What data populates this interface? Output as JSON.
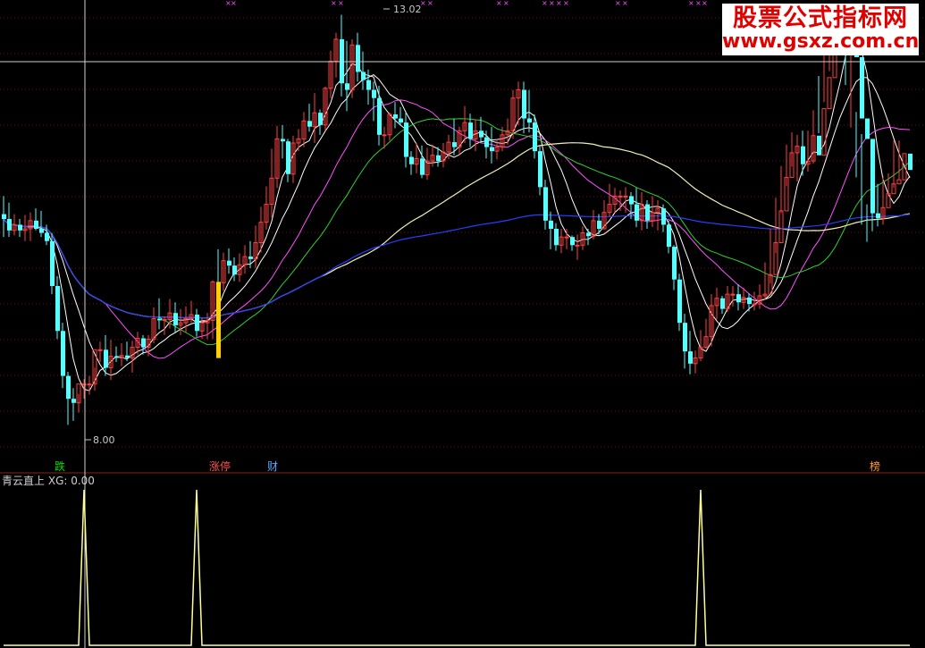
{
  "watermark": {
    "line1": "股票公式指标网",
    "line2": "www.gsxz.com.cn"
  },
  "indicator": {
    "name": "青云直上",
    "value_label": "XG: 0.00"
  },
  "annotations": {
    "high": "13.02",
    "low": "8.00"
  },
  "tags": [
    {
      "text": "跌",
      "color": "#00dd00"
    },
    {
      "text": "涨停",
      "color": "#ff5050"
    },
    {
      "text": "财",
      "color": "#5fa8ff"
    },
    {
      "text": "榜",
      "color": "#ff9a2a"
    }
  ],
  "colors": {
    "up": "#ff4040",
    "down": "#54ffff",
    "signal": "#ffd000",
    "ma_long": "#2a3cff",
    "ma_mid": "#ff50ff",
    "ma_slow": "#30d030",
    "ma_white": "#ffffff",
    "ma_cream": "#f0f0b8",
    "indicator": "#ffff99"
  },
  "chart_data": [
    {
      "type": "candlestick",
      "ylim": [
        7.6,
        13.2
      ],
      "x": [
        0,
        1,
        2,
        3,
        4,
        5,
        6,
        7,
        8,
        9,
        10,
        11,
        12,
        13,
        14,
        15,
        16,
        17,
        18,
        19,
        20,
        21,
        22,
        23,
        24,
        25,
        26,
        27,
        28,
        29,
        30,
        31,
        32,
        33,
        34,
        35,
        36,
        37,
        38,
        39,
        40,
        41,
        42,
        43,
        44,
        45,
        46,
        47,
        48,
        49,
        50,
        51,
        52,
        53,
        54,
        55,
        56,
        57,
        58,
        59,
        60,
        61,
        62,
        63,
        64,
        65,
        66,
        67,
        68,
        69,
        70,
        71,
        72,
        73,
        74,
        75,
        76,
        77,
        78,
        79,
        80,
        81,
        82,
        83,
        84,
        85,
        86,
        87,
        88,
        89,
        90,
        91,
        92,
        93,
        94,
        95,
        96,
        97,
        98,
        99,
        100,
        101,
        102,
        103,
        104,
        105,
        106,
        107,
        108,
        109,
        110,
        111,
        112,
        113,
        114,
        115,
        116,
        117,
        118,
        119,
        120,
        121,
        122,
        123,
        124,
        125,
        126,
        127,
        128,
        129,
        130,
        131,
        132,
        133,
        134,
        135,
        136,
        137,
        138,
        139,
        140,
        141,
        142,
        143,
        144,
        145,
        146,
        147,
        148,
        149,
        150,
        151,
        152,
        153,
        154,
        155,
        156,
        157,
        158,
        159,
        160,
        161,
        162,
        163,
        164,
        165,
        166,
        167,
        168,
        169
      ],
      "series": [
        {
          "name": "open",
          "values": [
            10.58,
            10.52,
            10.38,
            10.45,
            10.38,
            10.4,
            10.5,
            10.4,
            10.35,
            10.25,
            9.7,
            9.15,
            8.6,
            8.32,
            8.27,
            8.5,
            8.5,
            8.5,
            8.92,
            8.92,
            8.7,
            8.84,
            8.82,
            8.85,
            8.82,
            8.95,
            9.06,
            8.95,
            9.05,
            9.3,
            9.28,
            9.29,
            9.37,
            9.22,
            9.25,
            9.3,
            9.35,
            9.15,
            9.25,
            9.28,
            9.75,
            9.74,
            10.01,
            9.95,
            9.84,
            9.96,
            10.06,
            10.03,
            10.23,
            10.48,
            10.7,
            11.02,
            11.5,
            11.47,
            11.07,
            11.45,
            11.5,
            11.72,
            11.65,
            11.82,
            11.67,
            12.12,
            12.45,
            12.72,
            12.18,
            12.1,
            12.65,
            12.32,
            12.22,
            12.1,
            12.0,
            11.55,
            11.55,
            11.8,
            11.75,
            11.7,
            11.28,
            11.19,
            11.26,
            11.06,
            11.23,
            11.3,
            11.23,
            11.34,
            11.46,
            11.4,
            11.6,
            11.7,
            11.5,
            11.6,
            11.52,
            11.4,
            11.35,
            11.4,
            11.55,
            11.6,
            12.0,
            12.1,
            11.75,
            11.7,
            11.35,
            10.91,
            10.5,
            10.4,
            10.2,
            10.3,
            10.3,
            10.2,
            10.2,
            10.35,
            10.31,
            10.5,
            10.4,
            10.6,
            10.7,
            10.8,
            10.8,
            10.8,
            10.7,
            10.5,
            10.7,
            10.5,
            10.6,
            10.65,
            10.45,
            10.18,
            9.78,
            9.25,
            8.9,
            8.75,
            8.82,
            8.95,
            9.08,
            9.46,
            9.55,
            9.42,
            9.6,
            9.6,
            9.5,
            9.56,
            9.48,
            9.48,
            9.58,
            9.6,
            9.84,
            10.23,
            10.62,
            11.03,
            11.33,
            11.41,
            11.19,
            11.23,
            11.54,
            11.3,
            11.87,
            12.25,
            12.65,
            12.9,
            12.87,
            12.9,
            12.5,
            11.75,
            11.5,
            10.59,
            10.53,
            10.66,
            10.83,
            10.95,
            11.0,
            11.32
          ]
        },
        {
          "name": "high",
          "values": [
            10.8,
            10.72,
            10.58,
            10.52,
            10.57,
            10.6,
            10.65,
            10.62,
            10.45,
            10.35,
            9.82,
            9.25,
            8.65,
            8.45,
            8.38,
            8.56,
            8.6,
            8.7,
            9.02,
            9.1,
            9.04,
            8.96,
            9.0,
            9.02,
            9.03,
            9.14,
            9.1,
            9.1,
            9.44,
            9.55,
            9.33,
            9.54,
            9.5,
            9.42,
            9.45,
            9.52,
            9.42,
            9.31,
            9.37,
            9.77,
            10.15,
            10.11,
            10.16,
            10.05,
            10.1,
            10.2,
            10.25,
            10.44,
            10.67,
            10.92,
            11.38,
            11.66,
            11.67,
            11.5,
            11.54,
            11.62,
            11.83,
            11.93,
            12.06,
            11.86,
            12.14,
            12.58,
            12.8,
            13.02,
            12.7,
            12.72,
            12.8,
            12.57,
            12.35,
            12.2,
            12.15,
            11.65,
            11.82,
            11.95,
            11.89,
            11.84,
            11.35,
            11.45,
            11.42,
            11.39,
            11.43,
            11.4,
            11.45,
            11.55,
            11.75,
            11.65,
            11.9,
            11.81,
            11.73,
            11.77,
            11.6,
            11.65,
            11.5,
            11.65,
            11.75,
            12.1,
            12.2,
            12.2,
            12.1,
            11.8,
            11.41,
            11.0,
            10.61,
            10.47,
            10.4,
            10.4,
            10.32,
            10.33,
            10.43,
            10.4,
            10.63,
            10.58,
            10.75,
            10.95,
            10.9,
            10.87,
            10.91,
            10.85,
            10.9,
            10.85,
            10.75,
            10.8,
            10.75,
            10.7,
            10.5,
            10.2,
            9.85,
            9.36,
            9.15,
            8.91,
            9.16,
            9.3,
            9.6,
            9.68,
            9.58,
            9.7,
            9.7,
            9.72,
            9.68,
            9.61,
            9.63,
            9.72,
            9.99,
            10.4,
            10.78,
            11.17,
            11.43,
            11.58,
            11.55,
            11.6,
            11.6,
            11.85,
            12.27,
            12.7,
            13.0,
            12.95,
            13.1,
            12.93,
            12.6,
            11.83,
            11.56,
            10.7,
            10.76,
            10.95,
            11.05,
            11.08,
            11.48,
            11.48
          ]
        },
        {
          "name": "low",
          "values": [
            10.3,
            10.3,
            10.32,
            10.3,
            10.25,
            10.25,
            10.38,
            10.3,
            10.2,
            9.6,
            9.05,
            8.45,
            8.0,
            8.05,
            8.15,
            8.32,
            8.37,
            8.42,
            8.77,
            8.6,
            8.55,
            8.77,
            8.72,
            8.78,
            8.64,
            8.86,
            8.86,
            8.84,
            9.0,
            9.17,
            9.1,
            9.18,
            9.13,
            9.1,
            9.13,
            9.25,
            9.08,
            9.05,
            9.05,
            9.05,
            9.56,
            9.64,
            9.85,
            9.76,
            9.75,
            9.85,
            9.92,
            9.92,
            10.11,
            10.39,
            10.54,
            10.9,
            11.26,
            10.97,
            10.96,
            11.35,
            11.4,
            11.59,
            11.45,
            11.55,
            11.6,
            12.0,
            12.25,
            12.02,
            11.84,
            12.0,
            12.2,
            12.1,
            11.92,
            11.72,
            11.42,
            11.38,
            11.48,
            11.63,
            11.66,
            11.15,
            11.06,
            11.08,
            11.02,
            11.0,
            11.16,
            11.16,
            11.15,
            11.25,
            11.3,
            11.3,
            11.45,
            11.4,
            11.35,
            11.45,
            11.26,
            11.2,
            11.25,
            11.35,
            11.43,
            11.5,
            11.67,
            11.57,
            11.58,
            11.26,
            10.81,
            10.39,
            10.15,
            10.13,
            10.1,
            10.15,
            10.13,
            10.02,
            10.14,
            10.2,
            10.27,
            10.33,
            10.39,
            10.55,
            10.6,
            10.62,
            10.6,
            10.52,
            10.42,
            10.38,
            10.4,
            10.42,
            10.38,
            10.36,
            10.1,
            9.65,
            9.15,
            8.69,
            8.62,
            8.63,
            8.78,
            8.93,
            8.96,
            9.29,
            9.36,
            9.38,
            9.45,
            9.4,
            9.42,
            9.39,
            9.4,
            9.42,
            9.53,
            9.73,
            10.1,
            10.59,
            10.92,
            11.16,
            10.98,
            11.05,
            11.1,
            11.2,
            11.57,
            11.95,
            12.33,
            12.62,
            12.7,
            12.16,
            11.64,
            11.03,
            10.45,
            10.24,
            10.37,
            10.43,
            10.45,
            10.8,
            10.9,
            11.0
          ]
        },
        {
          "name": "close",
          "values": [
            10.52,
            10.38,
            10.45,
            10.38,
            10.4,
            10.5,
            10.4,
            10.35,
            10.25,
            9.7,
            9.15,
            8.6,
            8.32,
            8.27,
            8.5,
            8.5,
            8.5,
            8.92,
            8.92,
            8.7,
            8.84,
            8.82,
            8.85,
            8.82,
            8.95,
            9.06,
            8.95,
            9.05,
            9.3,
            9.28,
            9.29,
            9.37,
            9.22,
            9.25,
            9.3,
            9.35,
            9.15,
            9.25,
            9.28,
            9.75,
            9.74,
            10.01,
            9.95,
            9.84,
            9.96,
            10.06,
            10.03,
            10.23,
            10.48,
            10.7,
            11.02,
            11.5,
            11.47,
            11.07,
            11.45,
            11.5,
            11.72,
            11.65,
            11.82,
            11.67,
            12.12,
            12.45,
            12.72,
            12.18,
            12.1,
            12.65,
            12.32,
            12.22,
            12.1,
            12.0,
            11.55,
            11.55,
            11.8,
            11.75,
            11.7,
            11.28,
            11.19,
            11.26,
            11.06,
            11.23,
            11.3,
            11.23,
            11.34,
            11.46,
            11.4,
            11.6,
            11.7,
            11.5,
            11.6,
            11.52,
            11.4,
            11.35,
            11.4,
            11.55,
            11.6,
            12.0,
            12.1,
            11.75,
            11.7,
            11.35,
            10.91,
            10.5,
            10.4,
            10.2,
            10.3,
            10.3,
            10.2,
            10.2,
            10.35,
            10.31,
            10.5,
            10.4,
            10.6,
            10.7,
            10.8,
            10.8,
            10.8,
            10.7,
            10.5,
            10.7,
            10.5,
            10.6,
            10.65,
            10.45,
            10.18,
            9.78,
            9.25,
            8.9,
            8.75,
            8.82,
            8.95,
            9.08,
            9.46,
            9.55,
            9.42,
            9.6,
            9.6,
            9.5,
            9.56,
            9.48,
            9.48,
            9.58,
            9.6,
            9.84,
            10.23,
            10.62,
            11.03,
            11.33,
            11.41,
            11.19,
            11.23,
            11.54,
            11.3,
            11.87,
            12.25,
            12.65,
            12.9,
            12.87,
            12.9,
            12.5,
            11.75,
            11.5,
            10.59,
            10.53,
            10.66,
            10.83,
            10.95,
            11.0,
            11.32,
            11.12
          ]
        }
      ]
    },
    {
      "type": "line",
      "name_label": "XG",
      "ylim": [
        0,
        1
      ],
      "x": [
        0,
        14,
        15,
        16,
        35,
        36,
        37,
        129,
        130,
        131,
        169
      ],
      "series": [
        {
          "values": [
            0,
            0,
            1,
            0,
            0,
            1,
            0,
            0,
            1,
            0,
            0
          ]
        }
      ]
    }
  ]
}
